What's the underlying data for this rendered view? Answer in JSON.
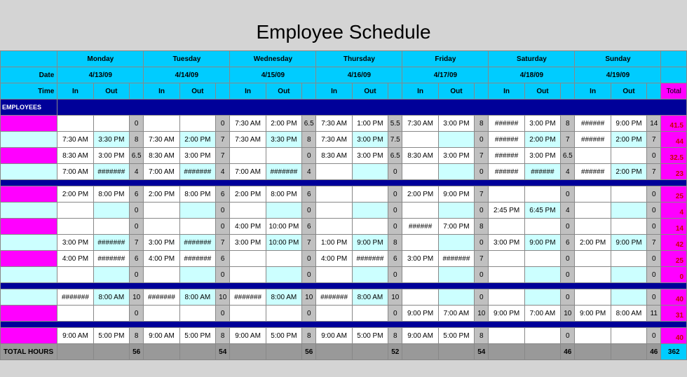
{
  "title": "Employee Schedule",
  "labels": {
    "date": "Date",
    "time": "Time",
    "in": "In",
    "out": "Out",
    "employees": "EMPLOYEES",
    "total": "Total",
    "total_hours": "TOTAL HOURS"
  },
  "days": [
    {
      "name": "Monday",
      "date": "4/13/09"
    },
    {
      "name": "Tuesday",
      "date": "4/14/09"
    },
    {
      "name": "Wednesday",
      "date": "4/15/09"
    },
    {
      "name": "Thursday",
      "date": "4/16/09"
    },
    {
      "name": "Friday",
      "date": "4/17/09"
    },
    {
      "name": "Saturday",
      "date": "4/18/09"
    },
    {
      "name": "Sunday",
      "date": "4/19/09"
    }
  ],
  "groups": [
    {
      "rows": [
        {
          "c": "pink",
          "d": [
            [
              "",
              "",
              "0"
            ],
            [
              "",
              "",
              "0"
            ],
            [
              "7:30 AM",
              "2:00 PM",
              "6.5"
            ],
            [
              "7:30 AM",
              "1:00 PM",
              "5.5"
            ],
            [
              "7:30 AM",
              "3:00 PM",
              "8"
            ],
            [
              "######",
              "3:00 PM",
              "8"
            ],
            [
              "######",
              "9:00 PM",
              "14"
            ]
          ],
          "t": "41.5"
        },
        {
          "c": "pale",
          "d": [
            [
              "7:30 AM",
              "3:30 PM",
              "8"
            ],
            [
              "7:30 AM",
              "2:00 PM",
              "7"
            ],
            [
              "7:30 AM",
              "3:30 PM",
              "8"
            ],
            [
              "7:30 AM",
              "3:00 PM",
              "7.5"
            ],
            [
              "",
              "",
              "0"
            ],
            [
              "######",
              "2:00 PM",
              "7"
            ],
            [
              "######",
              "2:00 PM",
              "7"
            ]
          ],
          "t": "44"
        },
        {
          "c": "pink",
          "d": [
            [
              "8:30 AM",
              "3:00 PM",
              "6.5"
            ],
            [
              "8:30 AM",
              "3:00 PM",
              "7"
            ],
            [
              "",
              "",
              "0"
            ],
            [
              "8:30 AM",
              "3:00 PM",
              "6.5"
            ],
            [
              "8:30 AM",
              "3:00 PM",
              "7"
            ],
            [
              "######",
              "3:00 PM",
              "6.5"
            ],
            [
              "",
              "",
              "0"
            ]
          ],
          "t": "32.5"
        },
        {
          "c": "pale",
          "d": [
            [
              "7:00 AM",
              "#######",
              "4"
            ],
            [
              "7:00 AM",
              "#######",
              "4"
            ],
            [
              "7:00 AM",
              "#######",
              "4"
            ],
            [
              "",
              "",
              "0"
            ],
            [
              "",
              "",
              "0"
            ],
            [
              "######",
              "######",
              "4"
            ],
            [
              "######",
              "2:00 PM",
              "7"
            ]
          ],
          "t": "23"
        }
      ]
    },
    {
      "rows": [
        {
          "c": "pink",
          "d": [
            [
              "2:00 PM",
              "8:00 PM",
              "6"
            ],
            [
              "2:00 PM",
              "8:00 PM",
              "6"
            ],
            [
              "2:00 PM",
              "8:00 PM",
              "6"
            ],
            [
              "",
              "",
              "0"
            ],
            [
              "2:00 PM",
              "9:00 PM",
              "7"
            ],
            [
              "",
              "",
              "0"
            ],
            [
              "",
              "",
              "0"
            ]
          ],
          "t": "25"
        },
        {
          "c": "pale",
          "d": [
            [
              "",
              "",
              "0"
            ],
            [
              "",
              "",
              "0"
            ],
            [
              "",
              "",
              "0"
            ],
            [
              "",
              "",
              "0"
            ],
            [
              "",
              "",
              "0"
            ],
            [
              "2:45 PM",
              "6:45 PM",
              "4"
            ],
            [
              "",
              "",
              "0"
            ]
          ],
          "t": "4"
        },
        {
          "c": "pink",
          "d": [
            [
              "",
              "",
              "0"
            ],
            [
              "",
              "",
              "0"
            ],
            [
              "4:00 PM",
              "10:00 PM",
              "6"
            ],
            [
              "",
              "",
              "0"
            ],
            [
              "######",
              "7:00 PM",
              "8"
            ],
            [
              "",
              "",
              "0"
            ],
            [
              "",
              "",
              "0"
            ]
          ],
          "t": "14"
        },
        {
          "c": "pale",
          "d": [
            [
              "3:00 PM",
              "#######",
              "7"
            ],
            [
              "3:00 PM",
              "#######",
              "7"
            ],
            [
              "3:00 PM",
              "10:00 PM",
              "7"
            ],
            [
              "1:00 PM",
              "9:00 PM",
              "8"
            ],
            [
              "",
              "",
              "0"
            ],
            [
              "3:00 PM",
              "9:00 PM",
              "6"
            ],
            [
              "2:00 PM",
              "9:00 PM",
              "7"
            ]
          ],
          "t": "42"
        },
        {
          "c": "pink",
          "d": [
            [
              "4:00 PM",
              "#######",
              "6"
            ],
            [
              "4:00 PM",
              "#######",
              "6"
            ],
            [
              "",
              "",
              "0"
            ],
            [
              "4:00 PM",
              "#######",
              "6"
            ],
            [
              "3:00 PM",
              "#######",
              "7"
            ],
            [
              "",
              "",
              "0"
            ],
            [
              "",
              "",
              "0"
            ]
          ],
          "t": "25"
        },
        {
          "c": "pale",
          "d": [
            [
              "",
              "",
              "0"
            ],
            [
              "",
              "",
              "0"
            ],
            [
              "",
              "",
              "0"
            ],
            [
              "",
              "",
              "0"
            ],
            [
              "",
              "",
              "0"
            ],
            [
              "",
              "",
              "0"
            ],
            [
              "",
              "",
              "0"
            ]
          ],
          "t": "0"
        }
      ]
    },
    {
      "rows": [
        {
          "c": "pale",
          "d": [
            [
              "#######",
              "8:00 AM",
              "10"
            ],
            [
              "#######",
              "8:00 AM",
              "10"
            ],
            [
              "#######",
              "8:00 AM",
              "10"
            ],
            [
              "#######",
              "8:00 AM",
              "10"
            ],
            [
              "",
              "",
              "0"
            ],
            [
              "",
              "",
              "0"
            ],
            [
              "",
              "",
              "0"
            ]
          ],
          "t": "40"
        },
        {
          "c": "pink",
          "d": [
            [
              "",
              "",
              "0"
            ],
            [
              "",
              "",
              "0"
            ],
            [
              "",
              "",
              "0"
            ],
            [
              "",
              "",
              "0"
            ],
            [
              "9:00 PM",
              "7:00 AM",
              "10"
            ],
            [
              "9:00 PM",
              "7:00 AM",
              "10"
            ],
            [
              "9:00 PM",
              "8:00 AM",
              "11"
            ]
          ],
          "t": "31"
        }
      ]
    },
    {
      "rows": [
        {
          "c": "pink",
          "d": [
            [
              "9:00 AM",
              "5:00 PM",
              "8"
            ],
            [
              "9:00 AM",
              "5:00 PM",
              "8"
            ],
            [
              "9:00 AM",
              "5:00 PM",
              "8"
            ],
            [
              "9:00 AM",
              "5:00 PM",
              "8"
            ],
            [
              "9:00 AM",
              "5:00 PM",
              "8"
            ],
            [
              "",
              "",
              "0"
            ],
            [
              "",
              "",
              "0"
            ]
          ],
          "t": "40"
        }
      ]
    }
  ],
  "totals": {
    "days": [
      "56",
      "54",
      "56",
      "52",
      "54",
      "46",
      "46"
    ],
    "grand": "362"
  }
}
